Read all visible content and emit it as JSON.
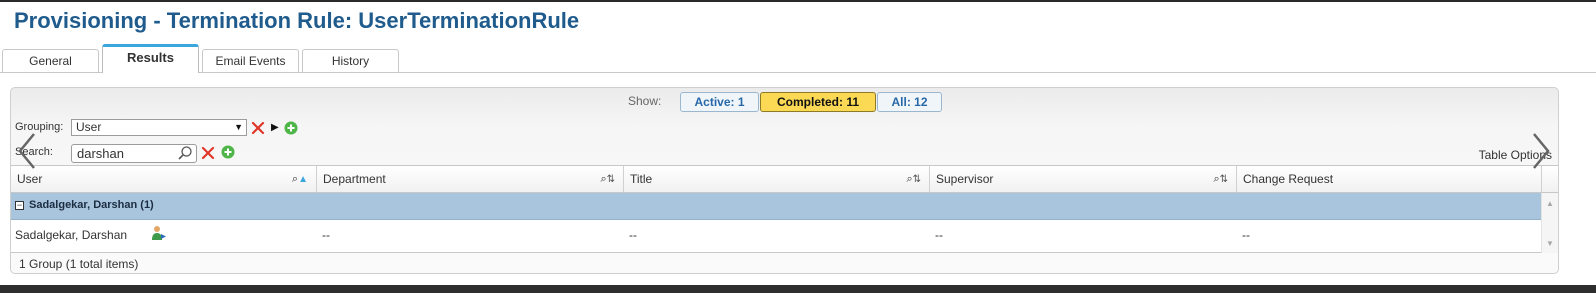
{
  "page": {
    "title": "Provisioning - Termination Rule: UserTerminationRule"
  },
  "tabs": [
    {
      "label": "General"
    },
    {
      "label": "Results"
    },
    {
      "label": "Email Events"
    },
    {
      "label": "History"
    }
  ],
  "filters": {
    "show_label": "Show:",
    "active_label": "Active: 1",
    "completed_label": "Completed: 11",
    "all_label": "All: 12",
    "selected": "Completed: 11"
  },
  "grouping": {
    "label": "Grouping:",
    "value": "User"
  },
  "search": {
    "label": "Search:",
    "value": "darshan"
  },
  "table_options_label": "Table Options",
  "table": {
    "columns": [
      "User",
      "Department",
      "Title",
      "Supervisor",
      "Change Request"
    ],
    "group": {
      "label": "Sadalgekar, Darshan (1)"
    },
    "rows": [
      {
        "user": "Sadalgekar, Darshan",
        "department": "--",
        "title": "--",
        "supervisor": "--",
        "change_request": "--"
      }
    ],
    "footer": "1 Group (1 total items)"
  },
  "colors": {
    "title": "#1f5b8c",
    "active_tab_accent": "#3aa6dd",
    "selected_filter": "#fbd954",
    "group_row": "#a9c4dd"
  },
  "icons": [
    "clear-icon",
    "play-icon",
    "add-icon",
    "magnifier-icon",
    "user-change-icon",
    "chevron-left-icon",
    "chevron-right-icon",
    "collapse-icon"
  ]
}
